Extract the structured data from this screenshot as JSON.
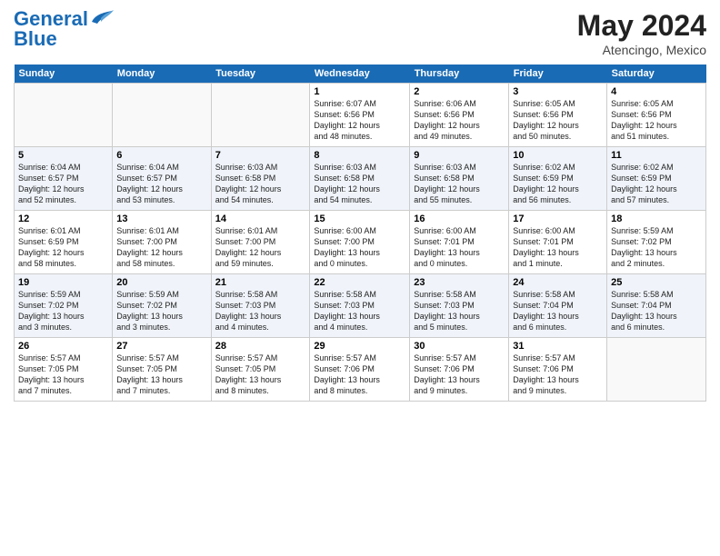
{
  "header": {
    "logo_general": "General",
    "logo_blue": "Blue",
    "month": "May 2024",
    "location": "Atencingo, Mexico"
  },
  "days_of_week": [
    "Sunday",
    "Monday",
    "Tuesday",
    "Wednesday",
    "Thursday",
    "Friday",
    "Saturday"
  ],
  "weeks": [
    [
      {
        "day": "",
        "info": ""
      },
      {
        "day": "",
        "info": ""
      },
      {
        "day": "",
        "info": ""
      },
      {
        "day": "1",
        "info": "Sunrise: 6:07 AM\nSunset: 6:56 PM\nDaylight: 12 hours\nand 48 minutes."
      },
      {
        "day": "2",
        "info": "Sunrise: 6:06 AM\nSunset: 6:56 PM\nDaylight: 12 hours\nand 49 minutes."
      },
      {
        "day": "3",
        "info": "Sunrise: 6:05 AM\nSunset: 6:56 PM\nDaylight: 12 hours\nand 50 minutes."
      },
      {
        "day": "4",
        "info": "Sunrise: 6:05 AM\nSunset: 6:56 PM\nDaylight: 12 hours\nand 51 minutes."
      }
    ],
    [
      {
        "day": "5",
        "info": "Sunrise: 6:04 AM\nSunset: 6:57 PM\nDaylight: 12 hours\nand 52 minutes."
      },
      {
        "day": "6",
        "info": "Sunrise: 6:04 AM\nSunset: 6:57 PM\nDaylight: 12 hours\nand 53 minutes."
      },
      {
        "day": "7",
        "info": "Sunrise: 6:03 AM\nSunset: 6:58 PM\nDaylight: 12 hours\nand 54 minutes."
      },
      {
        "day": "8",
        "info": "Sunrise: 6:03 AM\nSunset: 6:58 PM\nDaylight: 12 hours\nand 54 minutes."
      },
      {
        "day": "9",
        "info": "Sunrise: 6:03 AM\nSunset: 6:58 PM\nDaylight: 12 hours\nand 55 minutes."
      },
      {
        "day": "10",
        "info": "Sunrise: 6:02 AM\nSunset: 6:59 PM\nDaylight: 12 hours\nand 56 minutes."
      },
      {
        "day": "11",
        "info": "Sunrise: 6:02 AM\nSunset: 6:59 PM\nDaylight: 12 hours\nand 57 minutes."
      }
    ],
    [
      {
        "day": "12",
        "info": "Sunrise: 6:01 AM\nSunset: 6:59 PM\nDaylight: 12 hours\nand 58 minutes."
      },
      {
        "day": "13",
        "info": "Sunrise: 6:01 AM\nSunset: 7:00 PM\nDaylight: 12 hours\nand 58 minutes."
      },
      {
        "day": "14",
        "info": "Sunrise: 6:01 AM\nSunset: 7:00 PM\nDaylight: 12 hours\nand 59 minutes."
      },
      {
        "day": "15",
        "info": "Sunrise: 6:00 AM\nSunset: 7:00 PM\nDaylight: 13 hours\nand 0 minutes."
      },
      {
        "day": "16",
        "info": "Sunrise: 6:00 AM\nSunset: 7:01 PM\nDaylight: 13 hours\nand 0 minutes."
      },
      {
        "day": "17",
        "info": "Sunrise: 6:00 AM\nSunset: 7:01 PM\nDaylight: 13 hours\nand 1 minute."
      },
      {
        "day": "18",
        "info": "Sunrise: 5:59 AM\nSunset: 7:02 PM\nDaylight: 13 hours\nand 2 minutes."
      }
    ],
    [
      {
        "day": "19",
        "info": "Sunrise: 5:59 AM\nSunset: 7:02 PM\nDaylight: 13 hours\nand 3 minutes."
      },
      {
        "day": "20",
        "info": "Sunrise: 5:59 AM\nSunset: 7:02 PM\nDaylight: 13 hours\nand 3 minutes."
      },
      {
        "day": "21",
        "info": "Sunrise: 5:58 AM\nSunset: 7:03 PM\nDaylight: 13 hours\nand 4 minutes."
      },
      {
        "day": "22",
        "info": "Sunrise: 5:58 AM\nSunset: 7:03 PM\nDaylight: 13 hours\nand 4 minutes."
      },
      {
        "day": "23",
        "info": "Sunrise: 5:58 AM\nSunset: 7:03 PM\nDaylight: 13 hours\nand 5 minutes."
      },
      {
        "day": "24",
        "info": "Sunrise: 5:58 AM\nSunset: 7:04 PM\nDaylight: 13 hours\nand 6 minutes."
      },
      {
        "day": "25",
        "info": "Sunrise: 5:58 AM\nSunset: 7:04 PM\nDaylight: 13 hours\nand 6 minutes."
      }
    ],
    [
      {
        "day": "26",
        "info": "Sunrise: 5:57 AM\nSunset: 7:05 PM\nDaylight: 13 hours\nand 7 minutes."
      },
      {
        "day": "27",
        "info": "Sunrise: 5:57 AM\nSunset: 7:05 PM\nDaylight: 13 hours\nand 7 minutes."
      },
      {
        "day": "28",
        "info": "Sunrise: 5:57 AM\nSunset: 7:05 PM\nDaylight: 13 hours\nand 8 minutes."
      },
      {
        "day": "29",
        "info": "Sunrise: 5:57 AM\nSunset: 7:06 PM\nDaylight: 13 hours\nand 8 minutes."
      },
      {
        "day": "30",
        "info": "Sunrise: 5:57 AM\nSunset: 7:06 PM\nDaylight: 13 hours\nand 9 minutes."
      },
      {
        "day": "31",
        "info": "Sunrise: 5:57 AM\nSunset: 7:06 PM\nDaylight: 13 hours\nand 9 minutes."
      },
      {
        "day": "",
        "info": ""
      }
    ]
  ]
}
